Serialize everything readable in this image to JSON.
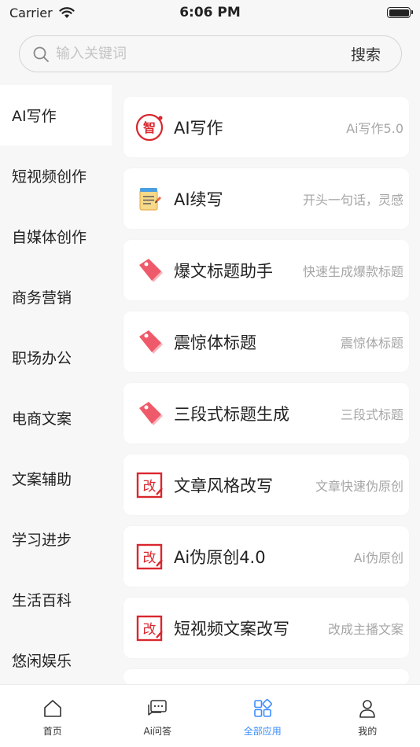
{
  "status_bar": {
    "carrier": "Carrier",
    "time": "6:06 PM",
    "battery_level": 1.0
  },
  "search": {
    "placeholder": "输入关键词",
    "value": "",
    "button_label": "搜索"
  },
  "sidebar": {
    "active_index": 0,
    "items": [
      {
        "label": "AI写作"
      },
      {
        "label": "短视频创作"
      },
      {
        "label": "自媒体创作"
      },
      {
        "label": "商务营销"
      },
      {
        "label": "职场办公"
      },
      {
        "label": "电商文案"
      },
      {
        "label": "文案辅助"
      },
      {
        "label": "学习进步"
      },
      {
        "label": "生活百科"
      },
      {
        "label": "悠闲娱乐"
      }
    ]
  },
  "tools": [
    {
      "icon": "zhi-seal-icon",
      "title": "AI写作",
      "subtitle": "Ai写作5.0"
    },
    {
      "icon": "notepad-icon",
      "title": "AI续写",
      "subtitle": "开头一句话，灵感"
    },
    {
      "icon": "tag-icon",
      "title": "爆文标题助手",
      "subtitle": "快速生成爆款标题"
    },
    {
      "icon": "tag-icon",
      "title": "震惊体标题",
      "subtitle": "震惊体标题"
    },
    {
      "icon": "tag-icon",
      "title": "三段式标题生成",
      "subtitle": "三段式标题"
    },
    {
      "icon": "rewrite-icon",
      "title": "文章风格改写",
      "subtitle": "文章快速伪原创"
    },
    {
      "icon": "rewrite-icon",
      "title": "Ai伪原创4.0",
      "subtitle": "Ai伪原创"
    },
    {
      "icon": "rewrite-icon",
      "title": "短视频文案改写",
      "subtitle": "改成主播文案"
    }
  ],
  "tabbar": {
    "active_index": 2,
    "accent": "#3b8cff",
    "tabs": [
      {
        "label": "首页",
        "icon": "home-icon"
      },
      {
        "label": "Ai问答",
        "icon": "chat-icon"
      },
      {
        "label": "全部应用",
        "icon": "apps-icon"
      },
      {
        "label": "我的",
        "icon": "user-icon"
      }
    ]
  }
}
